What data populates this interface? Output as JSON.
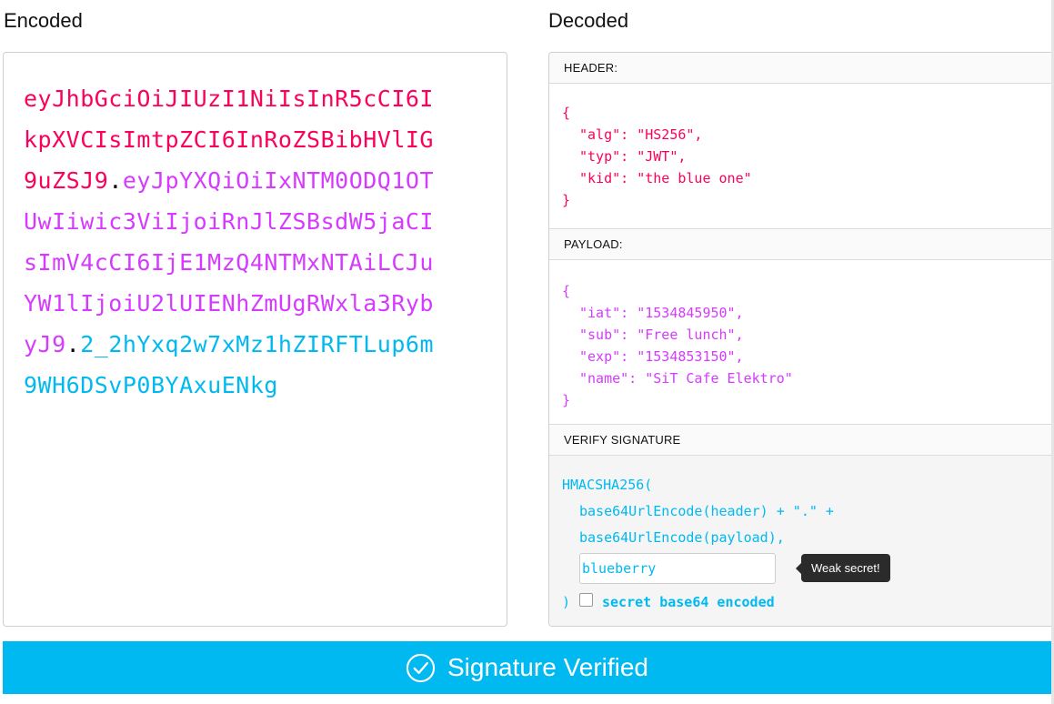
{
  "columns": {
    "encoded_title": "Encoded",
    "decoded_title": "Decoded"
  },
  "encoded": {
    "header": "eyJhbGciOiJIUzI1NiIsInR5cCI6IkpXVCIsImtpZCI6InRoZSBibHVlIG9uZSJ9",
    "dot1": ".",
    "payload": "eyJpYXQiOiIxNTM0ODQ1OTUwIiwic3ViIjoiRnJlZSBsdW5jaCIsImV4cCI6IjE1MzQ4NTMxNTAiLCJuYW1lIjoiU2lUIENhZmUgRWxla3RybyJ9",
    "dot2": ".",
    "signature": "2_2hYxq2w7xMz1hZIRFTLup6m9WH6DSvP0BYAxuENkg"
  },
  "header_section": {
    "label": "HEADER:",
    "lines": [
      "{",
      "\"alg\": \"HS256\",",
      "\"typ\": \"JWT\",",
      "\"kid\": \"the blue one\"",
      "}"
    ]
  },
  "payload_section": {
    "label": "PAYLOAD:",
    "lines": [
      "{",
      "\"iat\": \"1534845950\",",
      "\"sub\": \"Free lunch\",",
      "\"exp\": \"1534853150\",",
      "\"name\": \"SiT Cafe Elektro\"",
      "}"
    ]
  },
  "verify_section": {
    "label": "VERIFY SIGNATURE",
    "fn_open": "HMACSHA256(",
    "line1": "base64UrlEncode(header) + \".\" +",
    "line2": "base64UrlEncode(payload),",
    "secret_value": "blueberry",
    "tooltip": "Weak secret!",
    "close": ")",
    "b64_checkbox_label": "secret base64 encoded",
    "b64_checked": false
  },
  "status": {
    "label": "Signature Verified",
    "icon": "check-circle-icon"
  },
  "colors": {
    "header": "#fb015b",
    "payload": "#d63aff",
    "signature": "#00b9f1"
  }
}
